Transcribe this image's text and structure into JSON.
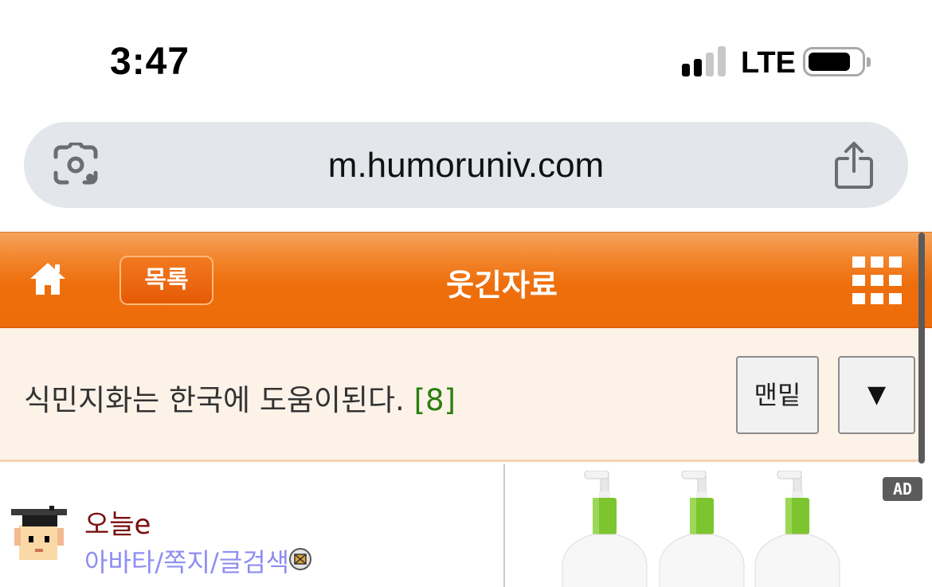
{
  "status": {
    "time": "3:47",
    "network": "LTE",
    "signal_bars": 2,
    "signal_total": 4
  },
  "browser": {
    "url": "m.humoruniv.com",
    "lens_icon": "camera-lens-icon",
    "share_icon": "share-icon"
  },
  "header": {
    "home_icon": "home-icon",
    "list_label": "목록",
    "title": "웃긴자료",
    "menu_icon": "grid-menu-icon",
    "accent": "#ee6d0b"
  },
  "post": {
    "title": "식민지화는 한국에 도움이된다.",
    "comment_count": "[8]",
    "bottom_button": "맨밑",
    "down_button": "▼"
  },
  "author": {
    "name": "오늘e",
    "links": "아바타/쪽지/글검색",
    "avatar_icon": "graduate-avatar-icon",
    "message_icon": "message-icon"
  },
  "ad": {
    "badge": "AD"
  },
  "colors": {
    "author_name": "#7a0e0e",
    "links": "#8e8ef2",
    "comment_count": "#2a7f0e"
  }
}
